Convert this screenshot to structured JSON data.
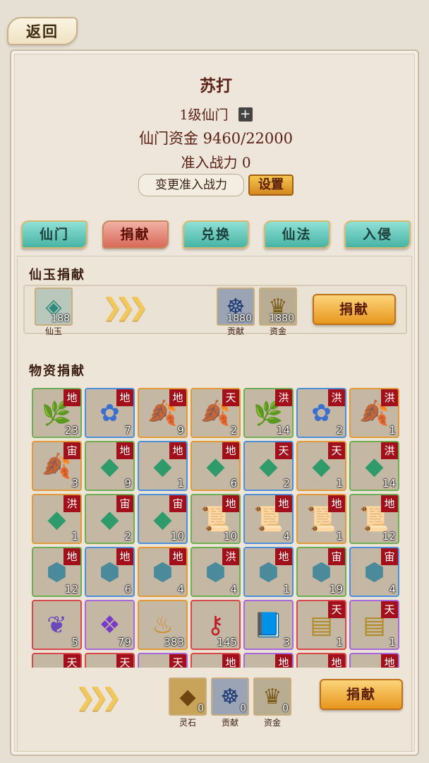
{
  "back_label": "返回",
  "sect": {
    "name": "苏打",
    "level": "1级仙门",
    "funds_label": "仙门资金",
    "funds_value": "9460/22000",
    "power_label": "准入战力",
    "power_value": "0",
    "change_power_label": "变更准入战力",
    "settings_label": "设置"
  },
  "tabs": [
    {
      "label": "仙门",
      "active": false
    },
    {
      "label": "捐献",
      "active": true
    },
    {
      "label": "兑换",
      "active": false
    },
    {
      "label": "仙法",
      "active": false
    },
    {
      "label": "入侵",
      "active": false
    }
  ],
  "jade_section": {
    "title": "仙玉捐献",
    "input": {
      "label": "仙玉",
      "count": "188",
      "icon": "jade-icon"
    },
    "rewards": [
      {
        "label": "贡献",
        "count": "1880",
        "icon": "meditation-icon"
      },
      {
        "label": "资金",
        "count": "1880",
        "icon": "gold-ingot-icon"
      }
    ],
    "button_label": "捐献"
  },
  "material_section": {
    "title": "物资捐献",
    "items": [
      {
        "icon": "herb-icon",
        "glyph": "🌿",
        "tag": "地",
        "count": "23",
        "quality": "green"
      },
      {
        "icon": "flower-icon",
        "glyph": "✿",
        "tag": "地",
        "count": "7",
        "quality": "blue"
      },
      {
        "icon": "herb-icon",
        "glyph": "🍂",
        "tag": "地",
        "count": "9",
        "quality": "orange"
      },
      {
        "icon": "herb-icon",
        "glyph": "🍂",
        "tag": "天",
        "count": "2",
        "quality": "orange"
      },
      {
        "icon": "herb-icon",
        "glyph": "🌿",
        "tag": "洪",
        "count": "14",
        "quality": "green"
      },
      {
        "icon": "flower-icon",
        "glyph": "✿",
        "tag": "洪",
        "count": "2",
        "quality": "blue"
      },
      {
        "icon": "herb-icon",
        "glyph": "🍂",
        "tag": "洪",
        "count": "1",
        "quality": "orange"
      },
      {
        "icon": "herb-icon",
        "glyph": "🍂",
        "tag": "宙",
        "count": "3",
        "quality": "orange"
      },
      {
        "icon": "spirit-stone-icon",
        "glyph": "◆",
        "tag": "地",
        "count": "9",
        "quality": "green"
      },
      {
        "icon": "spirit-stone-icon",
        "glyph": "◆",
        "tag": "地",
        "count": "1",
        "quality": "blue"
      },
      {
        "icon": "spirit-stone-icon",
        "glyph": "◆",
        "tag": "地",
        "count": "6",
        "quality": "orange"
      },
      {
        "icon": "spirit-stone-icon",
        "glyph": "◆",
        "tag": "天",
        "count": "2",
        "quality": "blue"
      },
      {
        "icon": "spirit-stone-icon",
        "glyph": "◆",
        "tag": "天",
        "count": "1",
        "quality": "orange"
      },
      {
        "icon": "spirit-stone-icon",
        "glyph": "◆",
        "tag": "洪",
        "count": "14",
        "quality": "green"
      },
      {
        "icon": "spirit-stone-icon",
        "glyph": "◆",
        "tag": "洪",
        "count": "1",
        "quality": "orange"
      },
      {
        "icon": "spirit-stone-icon",
        "glyph": "◆",
        "tag": "宙",
        "count": "2",
        "quality": "green"
      },
      {
        "icon": "spirit-stone-icon",
        "glyph": "◆",
        "tag": "宙",
        "count": "10",
        "quality": "blue"
      },
      {
        "icon": "scroll-icon",
        "glyph": "📜",
        "tag": "地",
        "count": "10",
        "quality": "green"
      },
      {
        "icon": "scroll-icon",
        "glyph": "📜",
        "tag": "地",
        "count": "4",
        "quality": "blue"
      },
      {
        "icon": "scroll-icon",
        "glyph": "📜",
        "tag": "地",
        "count": "1",
        "quality": "orange"
      },
      {
        "icon": "scroll-icon",
        "glyph": "📜",
        "tag": "地",
        "count": "12",
        "quality": "green"
      },
      {
        "icon": "ore-icon",
        "glyph": "⬢",
        "tag": "地",
        "count": "12",
        "quality": "green"
      },
      {
        "icon": "ore-icon",
        "glyph": "⬢",
        "tag": "地",
        "count": "6",
        "quality": "blue"
      },
      {
        "icon": "ore-icon",
        "glyph": "⬢",
        "tag": "地",
        "count": "4",
        "quality": "orange"
      },
      {
        "icon": "ore-icon",
        "glyph": "⬢",
        "tag": "洪",
        "count": "4",
        "quality": "green"
      },
      {
        "icon": "ore-icon",
        "glyph": "⬢",
        "tag": "地",
        "count": "1",
        "quality": "blue"
      },
      {
        "icon": "ore-icon",
        "glyph": "⬢",
        "tag": "宙",
        "count": "19",
        "quality": "green"
      },
      {
        "icon": "ore-icon",
        "glyph": "⬢",
        "tag": "宙",
        "count": "4",
        "quality": "blue"
      },
      {
        "icon": "feather-icon",
        "glyph": "❦",
        "tag": "",
        "count": "5",
        "quality": "red"
      },
      {
        "icon": "crystal-icon",
        "glyph": "❖",
        "tag": "",
        "count": "79",
        "quality": "purple"
      },
      {
        "icon": "gourd-icon",
        "glyph": "♨",
        "tag": "",
        "count": "383",
        "quality": "orange"
      },
      {
        "icon": "key-icon",
        "glyph": "⚷",
        "tag": "",
        "count": "145",
        "quality": "red"
      },
      {
        "icon": "book-icon",
        "glyph": "📘",
        "tag": "",
        "count": "3",
        "quality": "purple"
      },
      {
        "icon": "bamboo-scroll-icon",
        "glyph": "▤",
        "tag": "天",
        "count": "1",
        "quality": "red"
      },
      {
        "icon": "bamboo-scroll-icon",
        "glyph": "▤",
        "tag": "天",
        "count": "1",
        "quality": "purple"
      },
      {
        "icon": "bamboo-scroll-icon",
        "glyph": "▤",
        "tag": "天",
        "count": "",
        "quality": "red"
      },
      {
        "icon": "bamboo-scroll-icon",
        "glyph": "▤",
        "tag": "天",
        "count": "",
        "quality": "red"
      },
      {
        "icon": "orb-icon",
        "glyph": "●",
        "tag": "天",
        "count": "",
        "quality": "purple"
      },
      {
        "icon": "blade-icon",
        "glyph": "⟋",
        "tag": "地",
        "count": "",
        "quality": "red"
      },
      {
        "icon": "blade-icon",
        "glyph": "⟋",
        "tag": "地",
        "count": "",
        "quality": "purple"
      },
      {
        "icon": "blade-icon",
        "glyph": "⟋",
        "tag": "地",
        "count": "",
        "quality": "red"
      },
      {
        "icon": "blade-icon",
        "glyph": "⟋",
        "tag": "地",
        "count": "",
        "quality": "purple"
      }
    ],
    "rewards": [
      {
        "label": "灵石",
        "count": "0",
        "icon": "spirit-stone-icon"
      },
      {
        "label": "贡献",
        "count": "0",
        "icon": "meditation-icon"
      },
      {
        "label": "资金",
        "count": "0",
        "icon": "gold-ingot-icon"
      }
    ],
    "button_label": "捐献"
  }
}
